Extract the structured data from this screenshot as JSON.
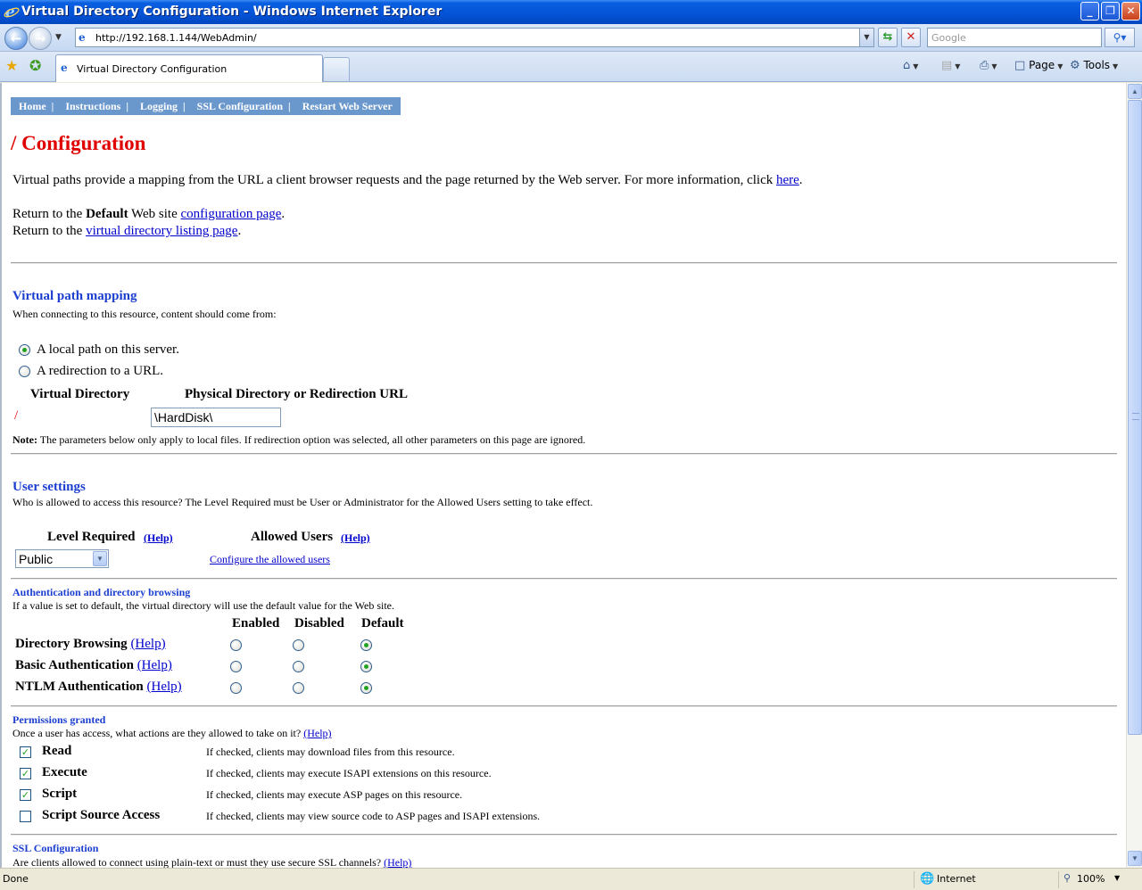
{
  "window": {
    "title": "Virtual Directory Configuration - Windows Internet Explorer",
    "minimize": "_",
    "maximize": "❐",
    "close": "✕"
  },
  "browser": {
    "url": "http://192.168.1.144/WebAdmin/",
    "search_placeholder": "Google",
    "tab_title": "Virtual Directory Configuration",
    "commands": {
      "page": "Page",
      "tools": "Tools"
    }
  },
  "menu": [
    "Home",
    "Instructions",
    "Logging",
    "SSL Configuration",
    "Restart Web Server"
  ],
  "page": {
    "title": "/ Configuration",
    "intro": "Virtual paths provide a mapping from the URL a client browser requests and the page returned by the Web server. For more information, click ",
    "intro_link": "here",
    "return1_pre": "Return to the ",
    "return1_bold": "Default",
    "return1_mid": " Web site ",
    "return1_link": "configuration page",
    "return2_pre": "Return to the ",
    "return2_link": "virtual directory listing page",
    "dot": "."
  },
  "vpath": {
    "heading": "Virtual path mapping",
    "desc": "When connecting to this resource, content should come from:",
    "option_local": "A local path on this server.",
    "option_redirect": "A redirection to a URL.",
    "selected": "local",
    "col_virtual": "Virtual Directory",
    "col_physical": "Physical Directory or Redirection URL",
    "virtual_value": "/",
    "physical_value": "\\HardDisk\\",
    "note_label": "Note:",
    "note": " The parameters below only apply to local files. If redirection option was selected, all other parameters on this page are ignored."
  },
  "users": {
    "heading": "User settings",
    "desc": "Who is allowed to access this resource? The Level Required must be User or Administrator for the Allowed Users setting to take effect.",
    "level_label": "Level Required",
    "allowed_label": "Allowed Users",
    "help": "(Help)",
    "level_value": "Public",
    "configure_link": "Configure the allowed users"
  },
  "auth": {
    "heading": "Authentication and directory browsing",
    "desc": "If a value is set to default, the virtual directory will use the default value for the Web site.",
    "columns": [
      "Enabled",
      "Disabled",
      "Default"
    ],
    "rows": [
      {
        "label": "Directory Browsing",
        "help": "(Help)",
        "selected": "Default"
      },
      {
        "label": "Basic Authentication",
        "help": "(Help)",
        "selected": "Default"
      },
      {
        "label": "NTLM Authentication",
        "help": "(Help)",
        "selected": "Default"
      }
    ]
  },
  "perms": {
    "heading": "Permissions granted",
    "desc": "Once a user has access, what actions are they allowed to take on it? ",
    "help": "(Help)",
    "items": [
      {
        "label": "Read",
        "checked": true,
        "desc": "If checked, clients may download files from this resource."
      },
      {
        "label": "Execute",
        "checked": true,
        "desc": "If checked, clients may execute ISAPI extensions on this resource."
      },
      {
        "label": "Script",
        "checked": true,
        "desc": "If checked, clients may execute ASP pages on this resource."
      },
      {
        "label": "Script Source Access",
        "checked": false,
        "desc": "If checked, clients may view source code to ASP pages and ISAPI extensions."
      }
    ]
  },
  "ssl": {
    "heading": "SSL Configuration",
    "desc": "Are clients allowed to connect using plain-text or must they use secure SSL channels? ",
    "help": "(Help)"
  },
  "status": {
    "left": "Done",
    "zone": "Internet",
    "zoom": "100%"
  }
}
